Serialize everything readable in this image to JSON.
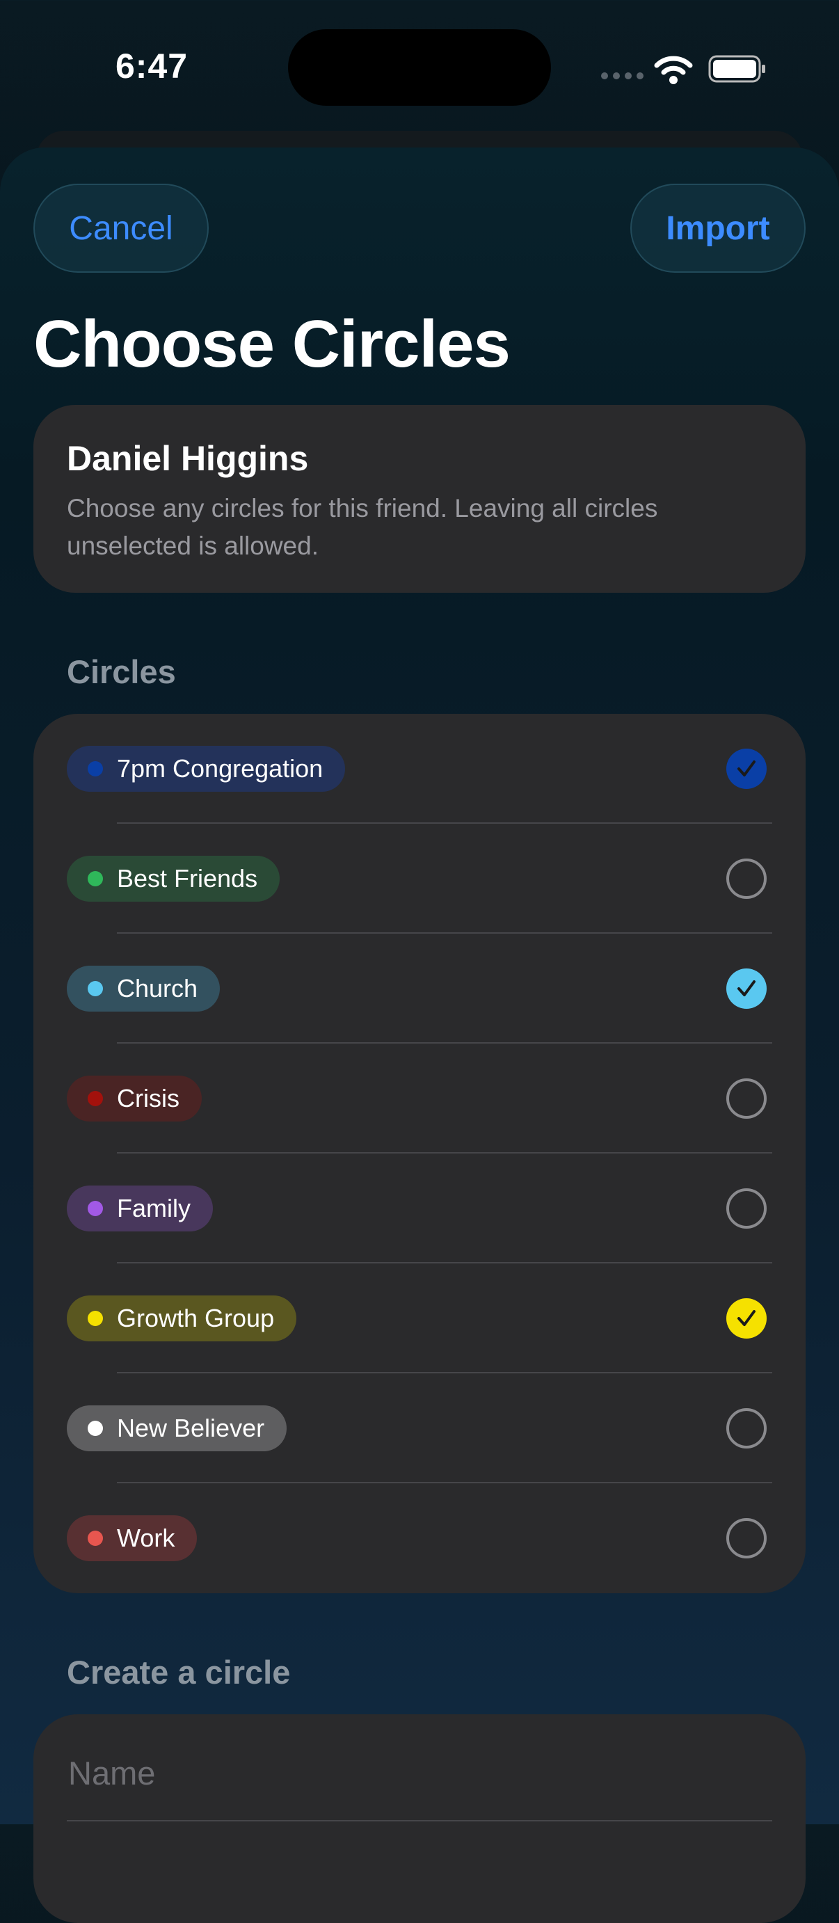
{
  "status_bar": {
    "time": "6:47"
  },
  "header": {
    "cancel_label": "Cancel",
    "import_label": "Import",
    "title": "Choose Circles"
  },
  "friend": {
    "name": "Daniel Higgins",
    "description": "Choose any circles for this friend. Leaving all circles unselected is allowed."
  },
  "circles_section": {
    "label": "Circles",
    "items": [
      {
        "label": "7pm Congregation",
        "color": "#0a3fa6",
        "tag_bg": "#23325a",
        "checked": true
      },
      {
        "label": "Best Friends",
        "color": "#2fb85a",
        "tag_bg": "#2a4a36",
        "checked": false
      },
      {
        "label": "Church",
        "color": "#5ac8f0",
        "tag_bg": "#33515f",
        "checked": true
      },
      {
        "label": "Crisis",
        "color": "#a3110c",
        "tag_bg": "#4a2424",
        "checked": false
      },
      {
        "label": "Family",
        "color": "#a259e6",
        "tag_bg": "#48375c",
        "checked": false
      },
      {
        "label": "Growth Group",
        "color": "#f5e100",
        "tag_bg": "#5a5720",
        "checked": true
      },
      {
        "label": "New Believer",
        "color": "#ffffff",
        "tag_bg": "#5e5e60",
        "checked": false
      },
      {
        "label": "Work",
        "color": "#e8564f",
        "tag_bg": "#583032",
        "checked": false
      }
    ]
  },
  "create_section": {
    "label": "Create a circle",
    "name_placeholder": "Name",
    "name_value": ""
  }
}
